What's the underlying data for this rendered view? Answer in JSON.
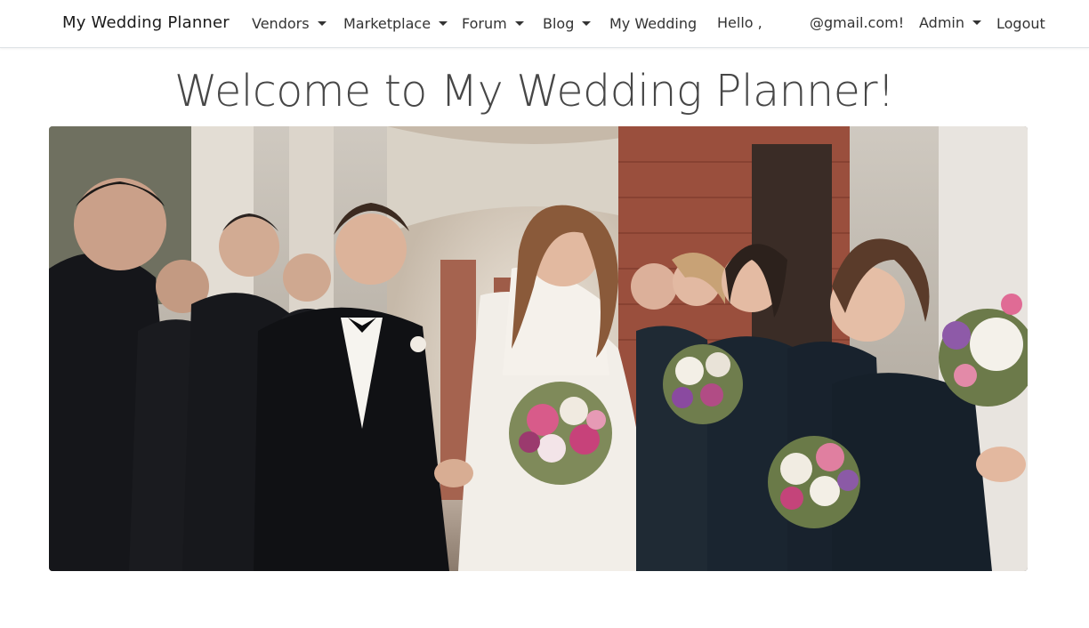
{
  "navbar": {
    "brand": "My Wedding Planner",
    "items": [
      {
        "label": "Vendors",
        "dropdown": true
      },
      {
        "label": "Marketplace",
        "dropdown": true
      },
      {
        "label": "Forum",
        "dropdown": true
      },
      {
        "label": "Blog",
        "dropdown": true
      },
      {
        "label": "My Wedding",
        "dropdown": false
      }
    ],
    "greeting_prefix": "Hello ,",
    "greeting_email": "@gmail.com!",
    "admin": {
      "label": "Admin",
      "dropdown": true
    },
    "logout": "Logout"
  },
  "main": {
    "title": "Welcome to My Wedding Planner!",
    "hero_image": {
      "icon": "wedding-party-photo"
    }
  },
  "colors": {
    "navbar_bg": "#ffffff",
    "title_text": "#474747",
    "nav_text": "#333333"
  }
}
